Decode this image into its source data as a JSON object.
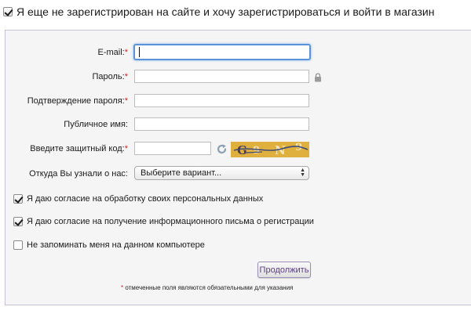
{
  "header": {
    "register_checked": true,
    "register_label": "Я еще не зарегистрирован на сайте и хочу зарегистрироваться и войти в магазин"
  },
  "form": {
    "required_mark": "*",
    "email_label": "E-mail:",
    "password_label": "Пароль:",
    "confirm_label": "Подтверждение пароля:",
    "public_name_label": "Публичное имя:",
    "captcha_label": "Введите защитный код:",
    "source_label": "Откуда Вы узнали о нас:",
    "source_selected": "Выберите вариант...",
    "captcha_text": "G 9 N 9",
    "email_value": "",
    "password_value": "",
    "confirm_value": "",
    "public_name_value": "",
    "captcha_value": ""
  },
  "consents": [
    {
      "label": "Я даю согласие на обработку своих персональных данных",
      "checked": true
    },
    {
      "label": "Я даю согласие на получение информационного письма о регистрации",
      "checked": true
    },
    {
      "label": "Не запоминать меня на данном компьютере",
      "checked": false
    }
  ],
  "submit_label": "Продолжить",
  "footnote_mark": "*",
  "footnote_text": " отмеченные поля являются обязательными для указания",
  "colors": {
    "required": "#cc2222",
    "panel_border": "#c9c1d4",
    "focus_ring": "#5b93d8",
    "button_text": "#5b3d86",
    "captcha_bg": "#e0b03f"
  },
  "icons": {
    "lock": "lock-icon",
    "refresh": "refresh-icon"
  }
}
